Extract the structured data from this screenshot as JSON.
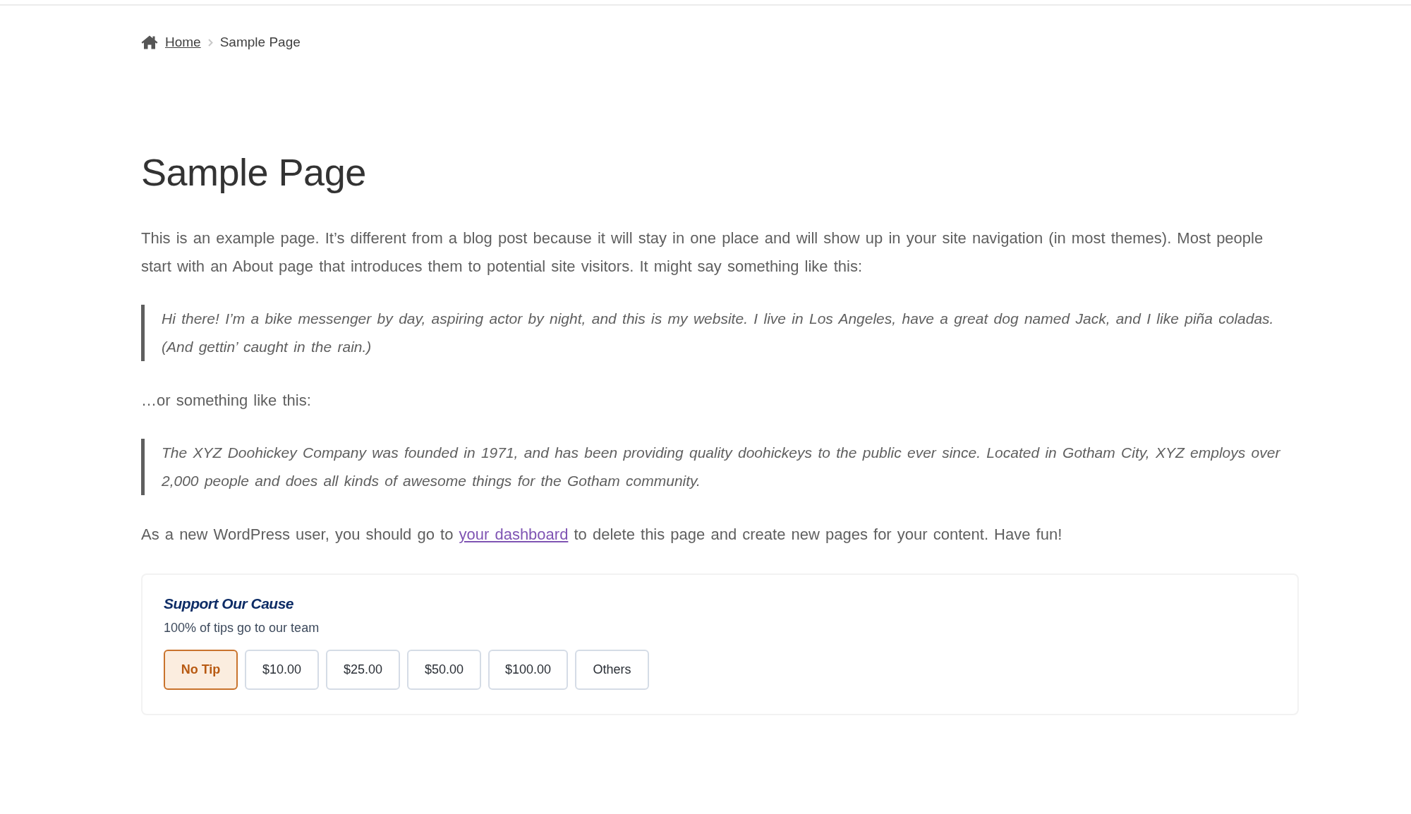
{
  "breadcrumb": {
    "home": "Home",
    "current": "Sample Page"
  },
  "page": {
    "title": "Sample Page",
    "content": [
      {
        "kind": "paragraph",
        "text": "This is an example page. It’s different from a blog post because it will stay in one place and will show up in your site navigation (in most themes). Most people start with an About page that introduces them to potential site visitors. It might say something like this:"
      },
      {
        "kind": "quote",
        "text": "Hi there! I’m a bike messenger by day, aspiring actor by night, and this is my website. I live in Los Angeles, have a great dog named Jack, and I like piña coladas. (And gettin’ caught in the rain.)"
      },
      {
        "kind": "paragraph",
        "text": "…or something like this:"
      },
      {
        "kind": "quote",
        "text": "The XYZ Doohickey Company was founded in 1971, and has been providing quality doohickeys to the public ever since. Located in Gotham City, XYZ employs over 2,000 people and does all kinds of awesome things for the Gotham community."
      },
      {
        "kind": "linked_paragraph",
        "segments": [
          {
            "kind": "text",
            "text": "As a new WordPress user, you should go to "
          },
          {
            "kind": "link",
            "text": "your dashboard"
          },
          {
            "kind": "text",
            "text": " to delete this page and create new pages for your content. Have fun!"
          }
        ]
      }
    ]
  },
  "tip": {
    "title": "Support Our Cause",
    "subtitle": "100% of tips go to our team",
    "options": [
      {
        "label": "No Tip",
        "selected": true
      },
      {
        "label": "$10.00",
        "selected": false
      },
      {
        "label": "$25.00",
        "selected": false
      },
      {
        "label": "$50.00",
        "selected": false
      },
      {
        "label": "$100.00",
        "selected": false
      },
      {
        "label": "Others",
        "selected": false
      }
    ]
  }
}
